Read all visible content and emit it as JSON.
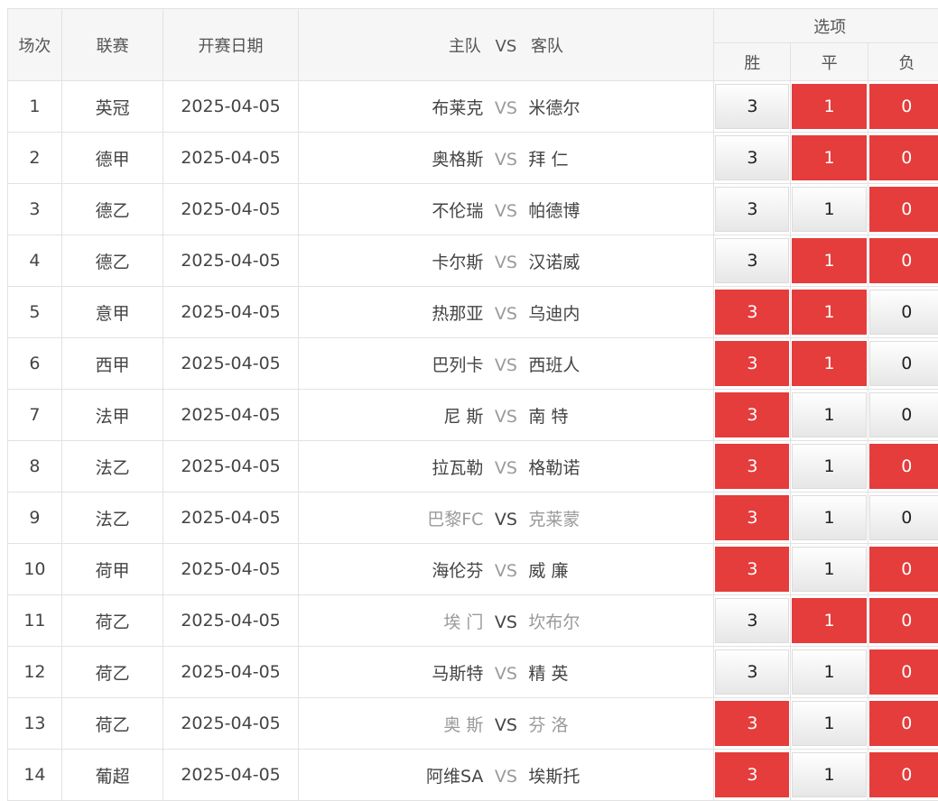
{
  "header": {
    "col_index": "场次",
    "col_league": "联赛",
    "col_date": "开赛日期",
    "col_home": "主队",
    "col_vs": "VS",
    "col_away": "客队",
    "col_options": "选项",
    "opt_win": "胜",
    "opt_draw": "平",
    "opt_loss": "负"
  },
  "matches": [
    {
      "no": "1",
      "league": "英冠",
      "date": "2025-04-05",
      "home": "布莱克",
      "vs": "VS",
      "away": "米德尔",
      "win": "3",
      "draw": "1",
      "loss": "0",
      "selected": [
        false,
        true,
        true
      ],
      "grey_home": false,
      "grey_away": false
    },
    {
      "no": "2",
      "league": "德甲",
      "date": "2025-04-05",
      "home": "奥格斯",
      "vs": "VS",
      "away": "拜 仁",
      "win": "3",
      "draw": "1",
      "loss": "0",
      "selected": [
        false,
        true,
        true
      ],
      "grey_home": false,
      "grey_away": false
    },
    {
      "no": "3",
      "league": "德乙",
      "date": "2025-04-05",
      "home": "不伦瑞",
      "vs": "VS",
      "away": "帕德博",
      "win": "3",
      "draw": "1",
      "loss": "0",
      "selected": [
        false,
        false,
        true
      ],
      "grey_home": false,
      "grey_away": false
    },
    {
      "no": "4",
      "league": "德乙",
      "date": "2025-04-05",
      "home": "卡尔斯",
      "vs": "VS",
      "away": "汉诺威",
      "win": "3",
      "draw": "1",
      "loss": "0",
      "selected": [
        false,
        true,
        true
      ],
      "grey_home": false,
      "grey_away": false
    },
    {
      "no": "5",
      "league": "意甲",
      "date": "2025-04-05",
      "home": "热那亚",
      "vs": "VS",
      "away": "乌迪内",
      "win": "3",
      "draw": "1",
      "loss": "0",
      "selected": [
        true,
        true,
        false
      ],
      "grey_home": false,
      "grey_away": false
    },
    {
      "no": "6",
      "league": "西甲",
      "date": "2025-04-05",
      "home": "巴列卡",
      "vs": "VS",
      "away": "西班人",
      "win": "3",
      "draw": "1",
      "loss": "0",
      "selected": [
        true,
        true,
        false
      ],
      "grey_home": false,
      "grey_away": false
    },
    {
      "no": "7",
      "league": "法甲",
      "date": "2025-04-05",
      "home": "尼 斯",
      "vs": "VS",
      "away": "南 特",
      "win": "3",
      "draw": "1",
      "loss": "0",
      "selected": [
        true,
        false,
        false
      ],
      "grey_home": false,
      "grey_away": false
    },
    {
      "no": "8",
      "league": "法乙",
      "date": "2025-04-05",
      "home": "拉瓦勒",
      "vs": "VS",
      "away": "格勒诺",
      "win": "3",
      "draw": "1",
      "loss": "0",
      "selected": [
        true,
        false,
        true
      ],
      "grey_home": false,
      "grey_away": false
    },
    {
      "no": "9",
      "league": "法乙",
      "date": "2025-04-05",
      "home": "巴黎FC",
      "vs": "VS",
      "away": "克莱蒙",
      "win": "3",
      "draw": "1",
      "loss": "0",
      "selected": [
        true,
        false,
        false
      ],
      "grey_home": true,
      "grey_away": true
    },
    {
      "no": "10",
      "league": "荷甲",
      "date": "2025-04-05",
      "home": "海伦芬",
      "vs": "VS",
      "away": "威 廉",
      "win": "3",
      "draw": "1",
      "loss": "0",
      "selected": [
        true,
        false,
        true
      ],
      "grey_home": false,
      "grey_away": false
    },
    {
      "no": "11",
      "league": "荷乙",
      "date": "2025-04-05",
      "home": "埃 门",
      "vs": "VS",
      "away": "坎布尔",
      "win": "3",
      "draw": "1",
      "loss": "0",
      "selected": [
        false,
        true,
        true
      ],
      "grey_home": true,
      "grey_away": true
    },
    {
      "no": "12",
      "league": "荷乙",
      "date": "2025-04-05",
      "home": "马斯特",
      "vs": "VS",
      "away": "精 英",
      "win": "3",
      "draw": "1",
      "loss": "0",
      "selected": [
        false,
        false,
        true
      ],
      "grey_home": false,
      "grey_away": false
    },
    {
      "no": "13",
      "league": "荷乙",
      "date": "2025-04-05",
      "home": "奥 斯",
      "vs": "VS",
      "away": "芬 洛",
      "win": "3",
      "draw": "1",
      "loss": "0",
      "selected": [
        true,
        false,
        true
      ],
      "grey_home": true,
      "grey_away": true
    },
    {
      "no": "14",
      "league": "葡超",
      "date": "2025-04-05",
      "home": "阿维SA",
      "vs": "VS",
      "away": "埃斯托",
      "win": "3",
      "draw": "1",
      "loss": "0",
      "selected": [
        true,
        false,
        true
      ],
      "grey_home": false,
      "grey_away": false
    }
  ],
  "colors": {
    "selected_bg": "#e53c3c",
    "unselected_bg": "#f2f2f2",
    "grey_text": "#9a9a9a"
  }
}
